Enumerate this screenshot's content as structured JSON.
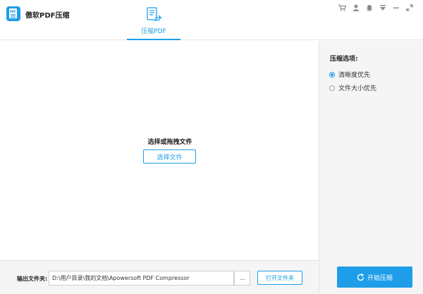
{
  "app": {
    "title": "傲软PDF压缩",
    "logo_text": "PDF",
    "accent": "#1e9ee8"
  },
  "tab": {
    "label": "压缩PDF",
    "icon": "document-compress-icon"
  },
  "window_controls": [
    "cart-icon",
    "user-icon",
    "bell-icon",
    "menu-icon",
    "minimize-icon",
    "maximize-icon"
  ],
  "drop_zone": {
    "prompt": "选择或拖拽文件",
    "select_button": "选择文件"
  },
  "options": {
    "title": "压缩选项:",
    "items": [
      {
        "label": "清晰度优先",
        "checked": true
      },
      {
        "label": "文件大小优先",
        "checked": false
      }
    ]
  },
  "output": {
    "label": "输出文件夹:",
    "path": "D:\\用户目录\\我的文档\\Apowersoft PDF Compressor",
    "browse_label": "...",
    "open_button": "打开文件夹"
  },
  "start_button": "开始压缩"
}
